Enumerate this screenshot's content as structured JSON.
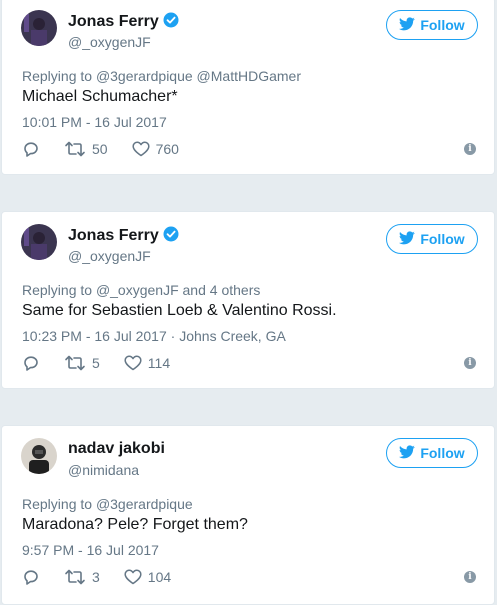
{
  "colors": {
    "accent": "#1da1f2",
    "muted": "#657786",
    "verified": "#1da1f2"
  },
  "tweets": [
    {
      "name": "Jonas Ferry",
      "verified": true,
      "handle": "@_oxygenJF",
      "follow_label": "Follow",
      "replying_prefix": "Replying to",
      "replying_to": "@3gerardpique @MattHDGamer",
      "text": "Michael Schumacher*",
      "timestamp": "10:01 PM - 16 Jul 2017",
      "location": "",
      "retweets": "50",
      "likes": "760"
    },
    {
      "name": "Jonas Ferry",
      "verified": true,
      "handle": "@_oxygenJF",
      "follow_label": "Follow",
      "replying_prefix": "Replying to",
      "replying_to": "@_oxygenJF and 4 others",
      "text": "Same for Sebastien Loeb & Valentino Rossi.",
      "timestamp": "10:23 PM - 16 Jul 2017",
      "location": " · Johns Creek, GA",
      "retweets": "5",
      "likes": "114"
    },
    {
      "name": "nadav jakobi",
      "verified": false,
      "handle": "@nimidana",
      "follow_label": "Follow",
      "replying_prefix": "Replying to",
      "replying_to": "@3gerardpique",
      "text": "Maradona? Pele? Forget them?",
      "timestamp": "9:57 PM - 16 Jul 2017",
      "location": "",
      "retweets": "3",
      "likes": "104"
    }
  ]
}
